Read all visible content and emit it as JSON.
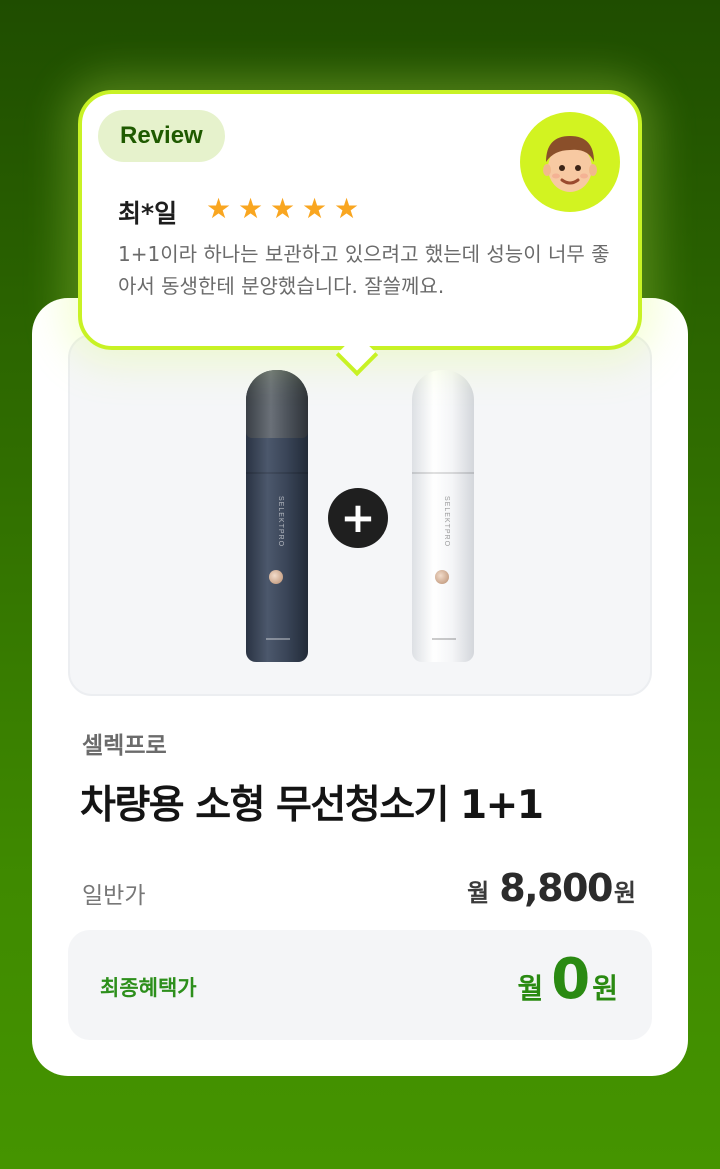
{
  "review": {
    "badge_label": "Review",
    "reviewer_name": "최*일",
    "rating": 5,
    "text": "1+1이라 하나는 보관하고 있으려고 했는데 성능이 너무 좋아서 동생한테 분양했습니다. 잘쓸께요.",
    "avatar_icon": "user-avatar-icon",
    "accent_color": "#c8f225"
  },
  "product": {
    "brand": "셀렉프로",
    "title": "차량용 소형 무선청소기 1+1",
    "image_icons": [
      "navy-vacuum-icon",
      "plus-icon",
      "white-vacuum-icon"
    ],
    "device_label": "SELEKTPRO"
  },
  "pricing": {
    "regular_label": "일반가",
    "regular_prefix": "월",
    "regular_value": "8,800",
    "regular_suffix": "원",
    "final_label": "최종혜택가",
    "final_prefix": "월",
    "final_value": "0",
    "final_suffix": "원",
    "final_color": "#2a8a12"
  }
}
